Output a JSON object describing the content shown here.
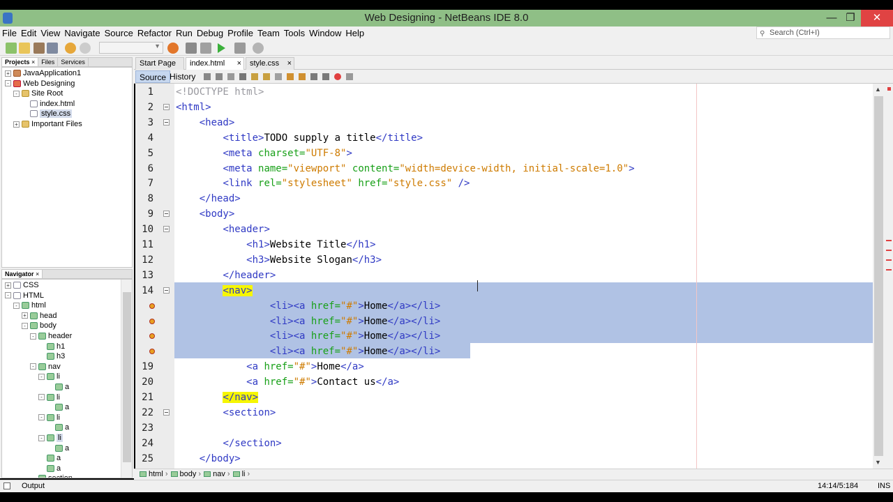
{
  "window": {
    "title": "Web Designing - NetBeans IDE 8.0"
  },
  "menu": [
    "File",
    "Edit",
    "View",
    "Navigate",
    "Source",
    "Refactor",
    "Run",
    "Debug",
    "Profile",
    "Team",
    "Tools",
    "Window",
    "Help"
  ],
  "search": {
    "placeholder": "Search (Ctrl+I)"
  },
  "projects_panel": {
    "tabs": [
      "Projects",
      "Files",
      "Services"
    ],
    "tree": [
      {
        "label": "JavaApplication1",
        "depth": 0,
        "toggle": "+",
        "icon": "pj"
      },
      {
        "label": "Web Designing",
        "depth": 0,
        "toggle": "-",
        "icon": "ht"
      },
      {
        "label": "Site Root",
        "depth": 1,
        "toggle": "-",
        "icon": "fo"
      },
      {
        "label": "index.html",
        "depth": 2,
        "toggle": "",
        "icon": "fi"
      },
      {
        "label": "style.css",
        "depth": 2,
        "toggle": "",
        "icon": "fi",
        "selected": true
      },
      {
        "label": "Important Files",
        "depth": 1,
        "toggle": "+",
        "icon": "fo"
      }
    ]
  },
  "navigator_panel": {
    "tab": "Navigator",
    "tree": [
      {
        "label": "CSS",
        "depth": 0,
        "toggle": "+",
        "icon": "fi"
      },
      {
        "label": "HTML",
        "depth": 0,
        "toggle": "-",
        "icon": "fi"
      },
      {
        "label": "html",
        "depth": 1,
        "toggle": "-",
        "icon": "el"
      },
      {
        "label": "head",
        "depth": 2,
        "toggle": "+",
        "icon": "el"
      },
      {
        "label": "body",
        "depth": 2,
        "toggle": "-",
        "icon": "el"
      },
      {
        "label": "header",
        "depth": 3,
        "toggle": "-",
        "icon": "el"
      },
      {
        "label": "h1",
        "depth": 4,
        "toggle": "",
        "icon": "el"
      },
      {
        "label": "h3",
        "depth": 4,
        "toggle": "",
        "icon": "el"
      },
      {
        "label": "nav",
        "depth": 3,
        "toggle": "-",
        "icon": "el"
      },
      {
        "label": "li",
        "depth": 4,
        "toggle": "-",
        "icon": "el"
      },
      {
        "label": "a",
        "depth": 5,
        "toggle": "",
        "icon": "el"
      },
      {
        "label": "li",
        "depth": 4,
        "toggle": "-",
        "icon": "el"
      },
      {
        "label": "a",
        "depth": 5,
        "toggle": "",
        "icon": "el"
      },
      {
        "label": "li",
        "depth": 4,
        "toggle": "-",
        "icon": "el"
      },
      {
        "label": "a",
        "depth": 5,
        "toggle": "",
        "icon": "el"
      },
      {
        "label": "li",
        "depth": 4,
        "toggle": "-",
        "icon": "el",
        "selected": true
      },
      {
        "label": "a",
        "depth": 5,
        "toggle": "",
        "icon": "el"
      },
      {
        "label": "a",
        "depth": 4,
        "toggle": "",
        "icon": "el"
      },
      {
        "label": "a",
        "depth": 4,
        "toggle": "",
        "icon": "el"
      },
      {
        "label": "section",
        "depth": 3,
        "toggle": "",
        "icon": "el"
      }
    ]
  },
  "editor": {
    "tabs": [
      "Start Page",
      "index.html",
      "style.css"
    ],
    "active_tab": "index.html",
    "source_label": "Source",
    "history_label": "History",
    "lines": [
      {
        "n": "1",
        "segs": [
          [
            "doc",
            "<!DOCTYPE html>"
          ]
        ]
      },
      {
        "n": "2",
        "segs": [
          [
            "tag",
            "<html>"
          ]
        ],
        "fold": true
      },
      {
        "n": "3",
        "segs": [
          [
            "",
            "    "
          ],
          [
            "tag",
            "<head>"
          ]
        ],
        "fold": true
      },
      {
        "n": "4",
        "segs": [
          [
            "",
            "        "
          ],
          [
            "tag",
            "<title>"
          ],
          [
            "",
            "TODO supply a title"
          ],
          [
            "tag",
            "</title>"
          ]
        ]
      },
      {
        "n": "5",
        "segs": [
          [
            "",
            "        "
          ],
          [
            "tag",
            "<meta "
          ],
          [
            "atn",
            "charset="
          ],
          [
            "atv",
            "\"UTF-8\""
          ],
          [
            "tag",
            ">"
          ]
        ]
      },
      {
        "n": "6",
        "segs": [
          [
            "",
            "        "
          ],
          [
            "tag",
            "<meta "
          ],
          [
            "atn",
            "name="
          ],
          [
            "atv",
            "\"viewport\""
          ],
          [
            "atn",
            " content="
          ],
          [
            "atv",
            "\"width=device-width, initial-scale=1.0\""
          ],
          [
            "tag",
            ">"
          ]
        ]
      },
      {
        "n": "7",
        "segs": [
          [
            "",
            "        "
          ],
          [
            "tag",
            "<link "
          ],
          [
            "atn",
            "rel="
          ],
          [
            "atv",
            "\"stylesheet\""
          ],
          [
            "atn",
            " href="
          ],
          [
            "atv",
            "\"style.css\""
          ],
          [
            "tag",
            " />"
          ]
        ]
      },
      {
        "n": "8",
        "segs": [
          [
            "",
            "    "
          ],
          [
            "tag",
            "</head>"
          ]
        ]
      },
      {
        "n": "9",
        "segs": [
          [
            "",
            "    "
          ],
          [
            "tag",
            "<body>"
          ]
        ],
        "fold": true
      },
      {
        "n": "10",
        "segs": [
          [
            "",
            "        "
          ],
          [
            "tag",
            "<header>"
          ]
        ],
        "fold": true
      },
      {
        "n": "11",
        "segs": [
          [
            "",
            "            "
          ],
          [
            "tag",
            "<h1>"
          ],
          [
            "",
            "Website Title"
          ],
          [
            "tag",
            "</h1>"
          ]
        ]
      },
      {
        "n": "12",
        "segs": [
          [
            "",
            "            "
          ],
          [
            "tag",
            "<h3>"
          ],
          [
            "",
            "Website Slogan"
          ],
          [
            "tag",
            "</h3>"
          ]
        ]
      },
      {
        "n": "13",
        "segs": [
          [
            "",
            "        "
          ],
          [
            "tag",
            "</header>"
          ]
        ]
      },
      {
        "n": "14",
        "segs": [
          [
            "",
            "        "
          ],
          [
            "tag hl",
            "<nav>"
          ]
        ],
        "fold": true
      },
      {
        "n": "",
        "segs": [
          [
            "",
            "                "
          ],
          [
            "tag",
            "<li><a "
          ],
          [
            "atn",
            "href="
          ],
          [
            "atv",
            "\"#\""
          ],
          [
            "tag",
            ">"
          ],
          [
            "",
            "Home"
          ],
          [
            "tag",
            "</a></li>"
          ]
        ],
        "bulb": true
      },
      {
        "n": "",
        "segs": [
          [
            "",
            "                "
          ],
          [
            "tag",
            "<li><a "
          ],
          [
            "atn",
            "href="
          ],
          [
            "atv",
            "\"#\""
          ],
          [
            "tag",
            ">"
          ],
          [
            "",
            "Home"
          ],
          [
            "tag",
            "</a></li>"
          ]
        ],
        "bulb": true
      },
      {
        "n": "",
        "segs": [
          [
            "",
            "                "
          ],
          [
            "tag",
            "<li><a "
          ],
          [
            "atn",
            "href="
          ],
          [
            "atv",
            "\"#\""
          ],
          [
            "tag",
            ">"
          ],
          [
            "",
            "Home"
          ],
          [
            "tag",
            "</a></li>"
          ]
        ],
        "bulb": true
      },
      {
        "n": "",
        "segs": [
          [
            "",
            "                "
          ],
          [
            "tag",
            "<li><a "
          ],
          [
            "atn",
            "href="
          ],
          [
            "atv",
            "\"#\""
          ],
          [
            "tag",
            ">"
          ],
          [
            "",
            "Home"
          ],
          [
            "tag",
            "</a></li>"
          ]
        ],
        "bulb": true
      },
      {
        "n": "19",
        "segs": [
          [
            "",
            "            "
          ],
          [
            "tag",
            "<a "
          ],
          [
            "atn",
            "href="
          ],
          [
            "atv",
            "\"#\""
          ],
          [
            "tag",
            ">"
          ],
          [
            "",
            "Home"
          ],
          [
            "tag",
            "</a>"
          ]
        ]
      },
      {
        "n": "20",
        "segs": [
          [
            "",
            "            "
          ],
          [
            "tag",
            "<a "
          ],
          [
            "atn",
            "href="
          ],
          [
            "atv",
            "\"#\""
          ],
          [
            "tag",
            ">"
          ],
          [
            "",
            "Contact us"
          ],
          [
            "tag",
            "</a>"
          ]
        ]
      },
      {
        "n": "21",
        "segs": [
          [
            "",
            "        "
          ],
          [
            "tag hl",
            "</nav>"
          ]
        ]
      },
      {
        "n": "22",
        "segs": [
          [
            "",
            "        "
          ],
          [
            "tag",
            "<section>"
          ]
        ],
        "fold": true
      },
      {
        "n": "23",
        "segs": [
          [
            "",
            ""
          ]
        ]
      },
      {
        "n": "24",
        "segs": [
          [
            "",
            "        "
          ],
          [
            "tag",
            "</section>"
          ]
        ]
      },
      {
        "n": "25",
        "segs": [
          [
            "",
            "    "
          ],
          [
            "tag",
            "</body>"
          ]
        ]
      }
    ]
  },
  "breadcrumb": [
    "html",
    "body",
    "nav",
    "li"
  ],
  "status": {
    "output": "Output",
    "position": "14:14/5:184",
    "mode": "INS"
  }
}
